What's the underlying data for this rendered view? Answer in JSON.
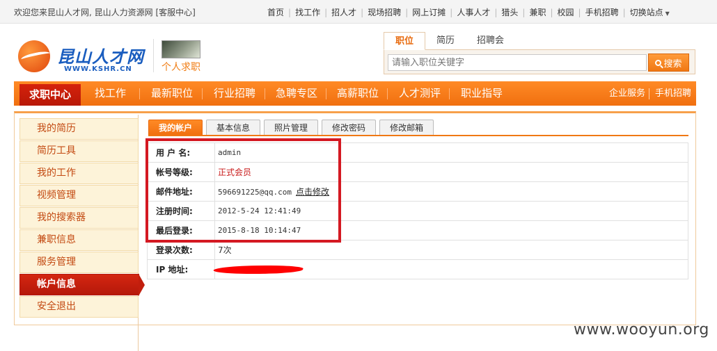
{
  "topbar": {
    "welcome": "欢迎您来昆山人才网, 昆山人力资源网 [客服中心]",
    "links": [
      "首页",
      "找工作",
      "招人才",
      "现场招聘",
      "网上订摊",
      "人事人才",
      "猎头",
      "兼职",
      "校园",
      "手机招聘"
    ],
    "switch_site": "切换站点"
  },
  "header": {
    "logo_text": "昆山人才网",
    "logo_url": "WWW.KSHR.CN",
    "section_label": "个人求职"
  },
  "search": {
    "tabs": [
      "职位",
      "简历",
      "招聘会"
    ],
    "placeholder": "请输入职位关键字",
    "button_label": "搜索"
  },
  "mainnav": {
    "active": "求职中心",
    "items": [
      "找工作",
      "最新职位",
      "行业招聘",
      "急聘专区",
      "高薪职位",
      "人才测评",
      "职业指导"
    ],
    "right": [
      "企业服务",
      "手机招聘"
    ]
  },
  "sidebar": {
    "items": [
      "我的简历",
      "简历工具",
      "我的工作",
      "视频管理",
      "我的搜索器",
      "兼职信息",
      "服务管理",
      "帐户信息",
      "安全退出"
    ]
  },
  "tabs": [
    "我的帐户",
    "基本信息",
    "照片管理",
    "修改密码",
    "修改邮箱"
  ],
  "account": {
    "username_label": "用 户 名:",
    "username": "admin",
    "level_label": "帐号等级:",
    "level": "正式会员",
    "email_label": "邮件地址:",
    "email": "596691225@qq.com",
    "email_edit": "点击修改",
    "register_label": "注册时间:",
    "register_time": "2012-5-24 12:41:49",
    "last_login_label": "最后登录:",
    "last_login": "2015-8-18 10:14:47",
    "login_count_label": "登录次数:",
    "login_count": "7次",
    "ip_label": "IP 地址:"
  },
  "colors": {
    "accent": "#f07813",
    "active_red": "#c21e0d",
    "highlight": "#d41922"
  },
  "watermark": "www.wooyun.org"
}
